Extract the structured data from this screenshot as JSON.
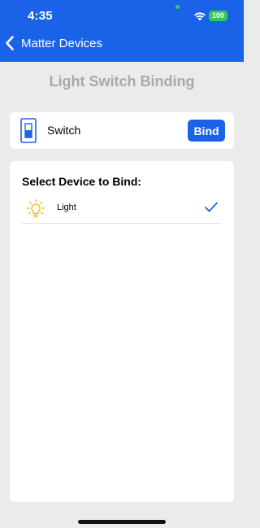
{
  "status_bar": {
    "time": "4:35",
    "battery": "100"
  },
  "nav": {
    "back_label": "Matter Devices"
  },
  "page": {
    "title": "Light Switch Binding"
  },
  "switch_card": {
    "label": "Switch",
    "icon": "light-switch-icon",
    "bind_label": "Bind"
  },
  "device_list": {
    "title": "Select Device to Bind:",
    "items": [
      {
        "label": "Light",
        "icon": "light-bulb-icon",
        "selected": true
      }
    ]
  },
  "colors": {
    "accent": "#1a63e8",
    "background": "#ebebeb",
    "title_gray": "#a9a9a9",
    "bulb_yellow": "#f2b705"
  }
}
